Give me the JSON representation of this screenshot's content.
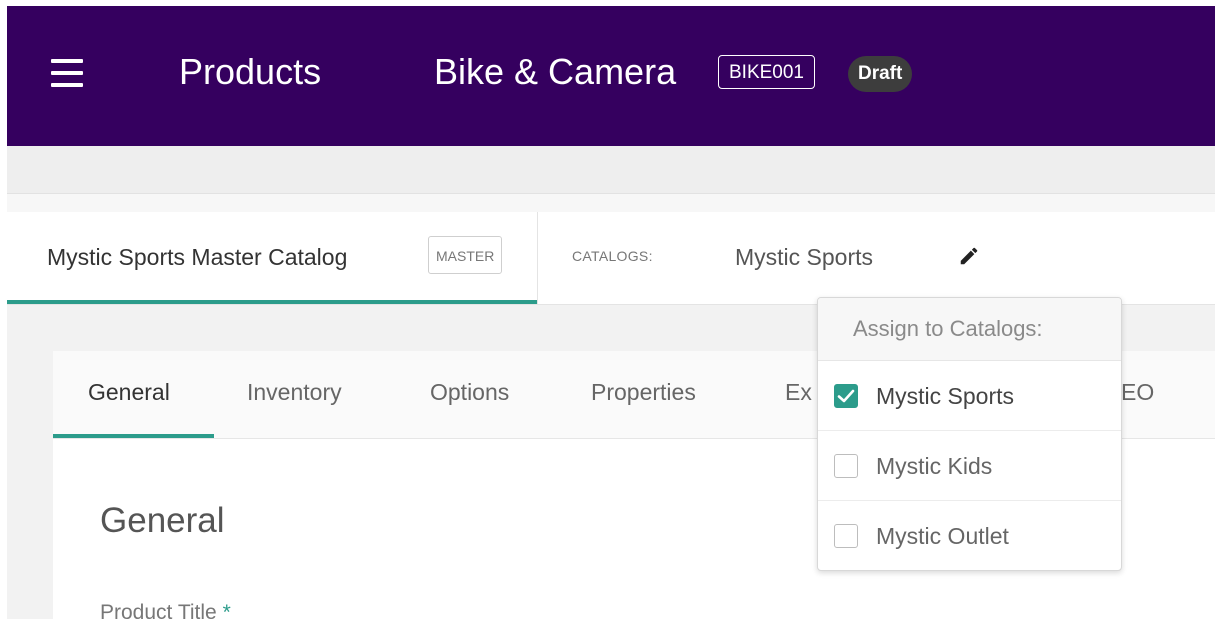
{
  "appbar": {
    "section_title": "Products",
    "product_title": "Bike & Camera",
    "sku": "BIKE001",
    "status": "Draft",
    "bg_color": "#35005f",
    "menu_icon": "hamburger-menu-icon"
  },
  "catalog_bar": {
    "master_catalog_name": "Mystic Sports Master Catalog",
    "master_badge": "MASTER",
    "catalogs_label": "CATALOGS:",
    "catalogs_value": "Mystic Sports",
    "edit_icon": "pencil-icon",
    "accent_color": "#2c9c8b"
  },
  "tabs": [
    {
      "label": "General",
      "active": true
    },
    {
      "label": "Inventory",
      "active": false
    },
    {
      "label": "Options",
      "active": false
    },
    {
      "label": "Properties",
      "active": false
    },
    {
      "label": "Ex",
      "active": false
    },
    {
      "label": "EO",
      "active": false
    }
  ],
  "general": {
    "section_title": "General",
    "product_title_label": "Product Title",
    "required_marker": "*"
  },
  "catalog_dropdown": {
    "header": "Assign to Catalogs:",
    "items": [
      {
        "label": "Mystic Sports",
        "checked": true
      },
      {
        "label": "Mystic Kids",
        "checked": false
      },
      {
        "label": "Mystic Outlet",
        "checked": false
      }
    ]
  }
}
